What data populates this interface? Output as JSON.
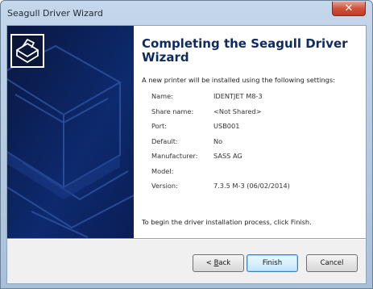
{
  "window": {
    "title": "Seagull Driver Wizard",
    "close_glyph": "✕"
  },
  "side_panel": {
    "icon": "printer-wizard-icon",
    "bg_color": "#0b1a4a"
  },
  "main": {
    "heading": "Completing the Seagull Driver Wizard",
    "intro": "A new printer will be installed using the following settings:",
    "settings": [
      {
        "label": "Name:",
        "value": "IDENTJET M8-3"
      },
      {
        "label": "Share name:",
        "value": "<Not Shared>"
      },
      {
        "label": "Port:",
        "value": "USB001"
      },
      {
        "label": "Default:",
        "value": "No"
      },
      {
        "label": "Manufacturer:",
        "value": "SASS AG"
      },
      {
        "label": "Model:",
        "value": ""
      },
      {
        "label": "Version:",
        "value": "7.3.5 M-3 (06/02/2014)"
      }
    ],
    "outro": "To begin the driver installation process, click Finish."
  },
  "buttons": {
    "back_prefix": "< ",
    "back_mnemonic": "B",
    "back_rest": "ack",
    "finish": "Finish",
    "cancel": "Cancel"
  },
  "colors": {
    "heading": "#0f2a5e",
    "close_button": "#c13b23",
    "default_button_border": "#3c7fb1"
  }
}
